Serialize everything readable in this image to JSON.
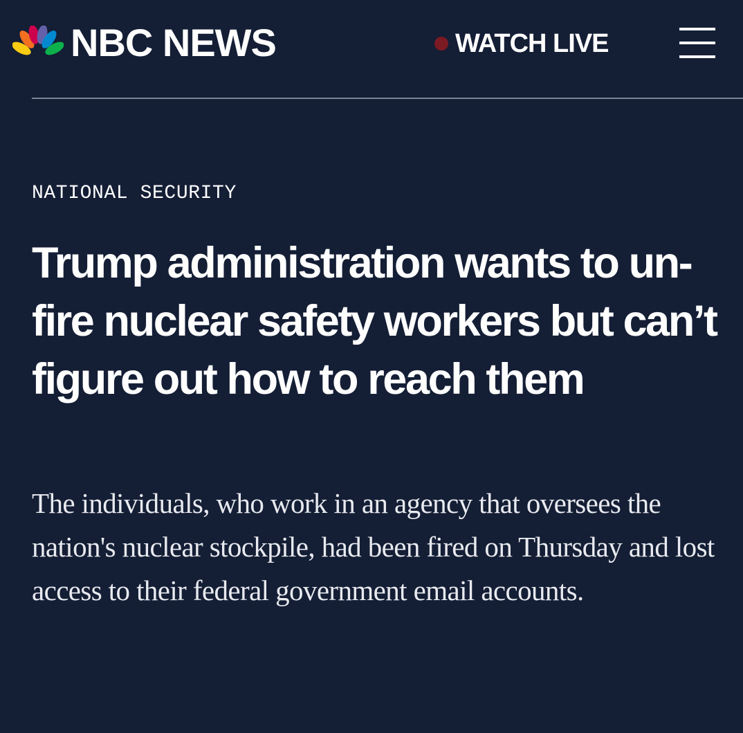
{
  "header": {
    "brand": "NBC NEWS",
    "watch_live": "WATCH LIVE",
    "menu_icon": "hamburger-menu-icon",
    "logo_icon": "nbc-peacock-icon"
  },
  "colors": {
    "background": "#141e35",
    "divider": "#7c8497",
    "live_dot": "#7a1a22",
    "text": "#ffffff",
    "peacock": [
      "#fccc12",
      "#f37021",
      "#cc004c",
      "#6460aa",
      "#0089d0",
      "#0db14b"
    ]
  },
  "article": {
    "section": "NATIONAL SECURITY",
    "headline": "Trump administration wants to un-fire nuclear safety workers but can’t figure out how to reach them",
    "dek": "The individuals, who work in an agency that oversees the nation's nuclear stockpile, had been fired on Thursday and lost access to their federal government email accounts."
  }
}
